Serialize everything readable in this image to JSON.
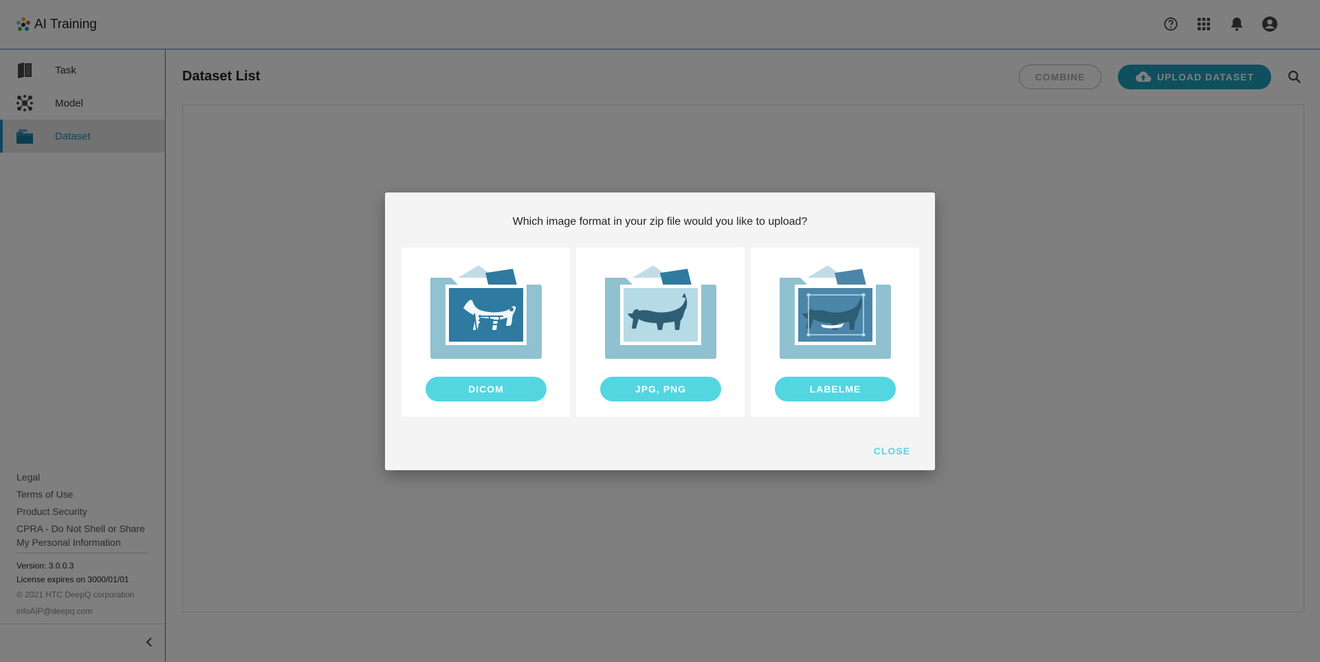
{
  "app": {
    "title": "AI Training"
  },
  "header": {
    "icons": [
      "help-icon",
      "apps-grid-icon",
      "notification-bell-icon",
      "account-icon"
    ]
  },
  "sidebar": {
    "items": [
      {
        "label": "Task",
        "icon": "book-icon"
      },
      {
        "label": "Model",
        "icon": "network-icon"
      },
      {
        "label": "Dataset",
        "icon": "folder-stack-icon",
        "active": true
      }
    ],
    "footer_links": [
      "Legal",
      "Terms of Use",
      "Product Security",
      "CPRA - Do Not Shell or Share My Personal Information"
    ],
    "version": "Version: 3.0.0.3",
    "license": "License expires on 3000/01/01",
    "copyright": "© 2021 HTC DeepQ corporation",
    "email": "infoAIP@deepq.com"
  },
  "main": {
    "title": "Dataset List",
    "combine_label": "COMBINE",
    "upload_label": "UPLOAD DATASET"
  },
  "dialog": {
    "question": "Which image format in your zip file would you like to upload?",
    "options": [
      {
        "label": "DICOM"
      },
      {
        "label": "JPG, PNG"
      },
      {
        "label": "LABELME"
      }
    ],
    "close_label": "CLOSE"
  },
  "colors": {
    "accent": "#1c8fb8",
    "upload": "#1f9fbd",
    "option_button": "#53d6e0",
    "folder_light": "#8fc1d0",
    "folder_dark": "#2e7aa0"
  }
}
